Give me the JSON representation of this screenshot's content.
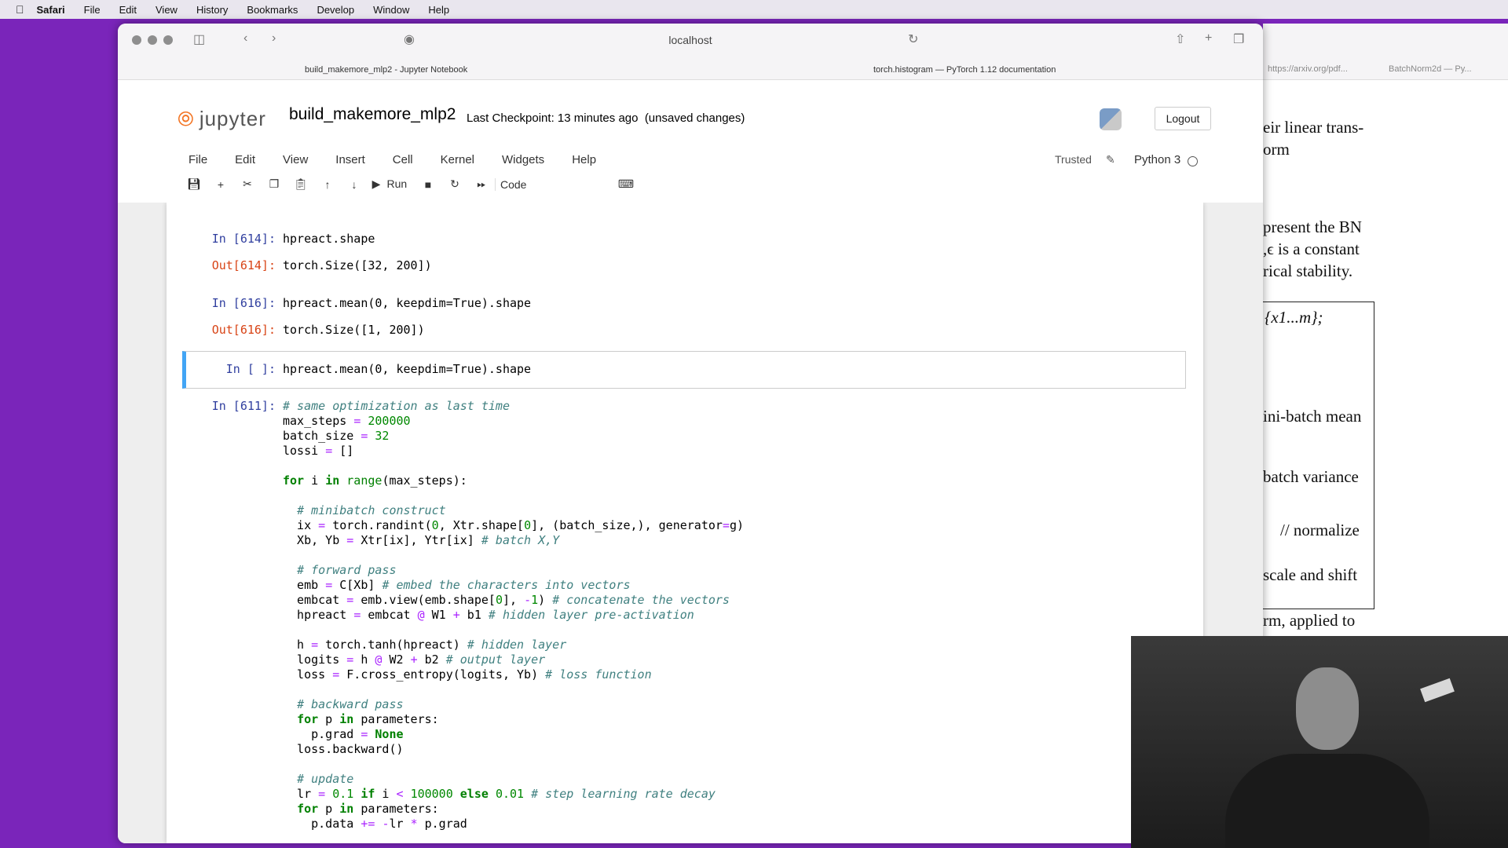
{
  "macos_menubar": {
    "app": "Safari",
    "items": [
      "File",
      "Edit",
      "View",
      "History",
      "Bookmarks",
      "Develop",
      "Window",
      "Help"
    ]
  },
  "browser": {
    "url": "localhost",
    "tabs": [
      "build_makemore_mlp2 - Jupyter Notebook",
      "torch.histogram — PyTorch 1.12 documentation"
    ]
  },
  "jupyter": {
    "logo": "jupyter",
    "notebook_title": "build_makemore_mlp2",
    "checkpoint": "Last Checkpoint: 13 minutes ago",
    "unsaved": "(unsaved changes)",
    "logout": "Logout",
    "menu": [
      "File",
      "Edit",
      "View",
      "Insert",
      "Cell",
      "Kernel",
      "Widgets",
      "Help"
    ],
    "trusted": "Trusted",
    "kernel_name": "Python 3",
    "run_label": "Run",
    "cell_type": "Code"
  },
  "cells": {
    "c1_prompt": "In [614]:",
    "c1_code": "hpreact.shape",
    "c1_out_prompt": "Out[614]:",
    "c1_out": "torch.Size([32, 200])",
    "c2_prompt": "In [616]:",
    "c2_code": "hpreact.mean(0, keepdim=True).shape",
    "c2_out_prompt": "Out[616]:",
    "c2_out": "torch.Size([1, 200])",
    "c3_prompt": "In [ ]:",
    "c3_code": "hpreact.mean(0, keepdim=True).shape",
    "c4_prompt": "In [611]:"
  },
  "pdf_side": {
    "tabs": [
      "https://arxiv.org/pdf...",
      "BatchNorm2d — Py..."
    ],
    "lines": [
      "eir linear trans-",
      "orm",
      "present the BN",
      ",ϵ is a constant",
      "rical stability.",
      "{x1...m};",
      "ini-batch mean",
      "batch variance",
      "// normalize",
      "scale and shift",
      "rm, applied to"
    ]
  }
}
